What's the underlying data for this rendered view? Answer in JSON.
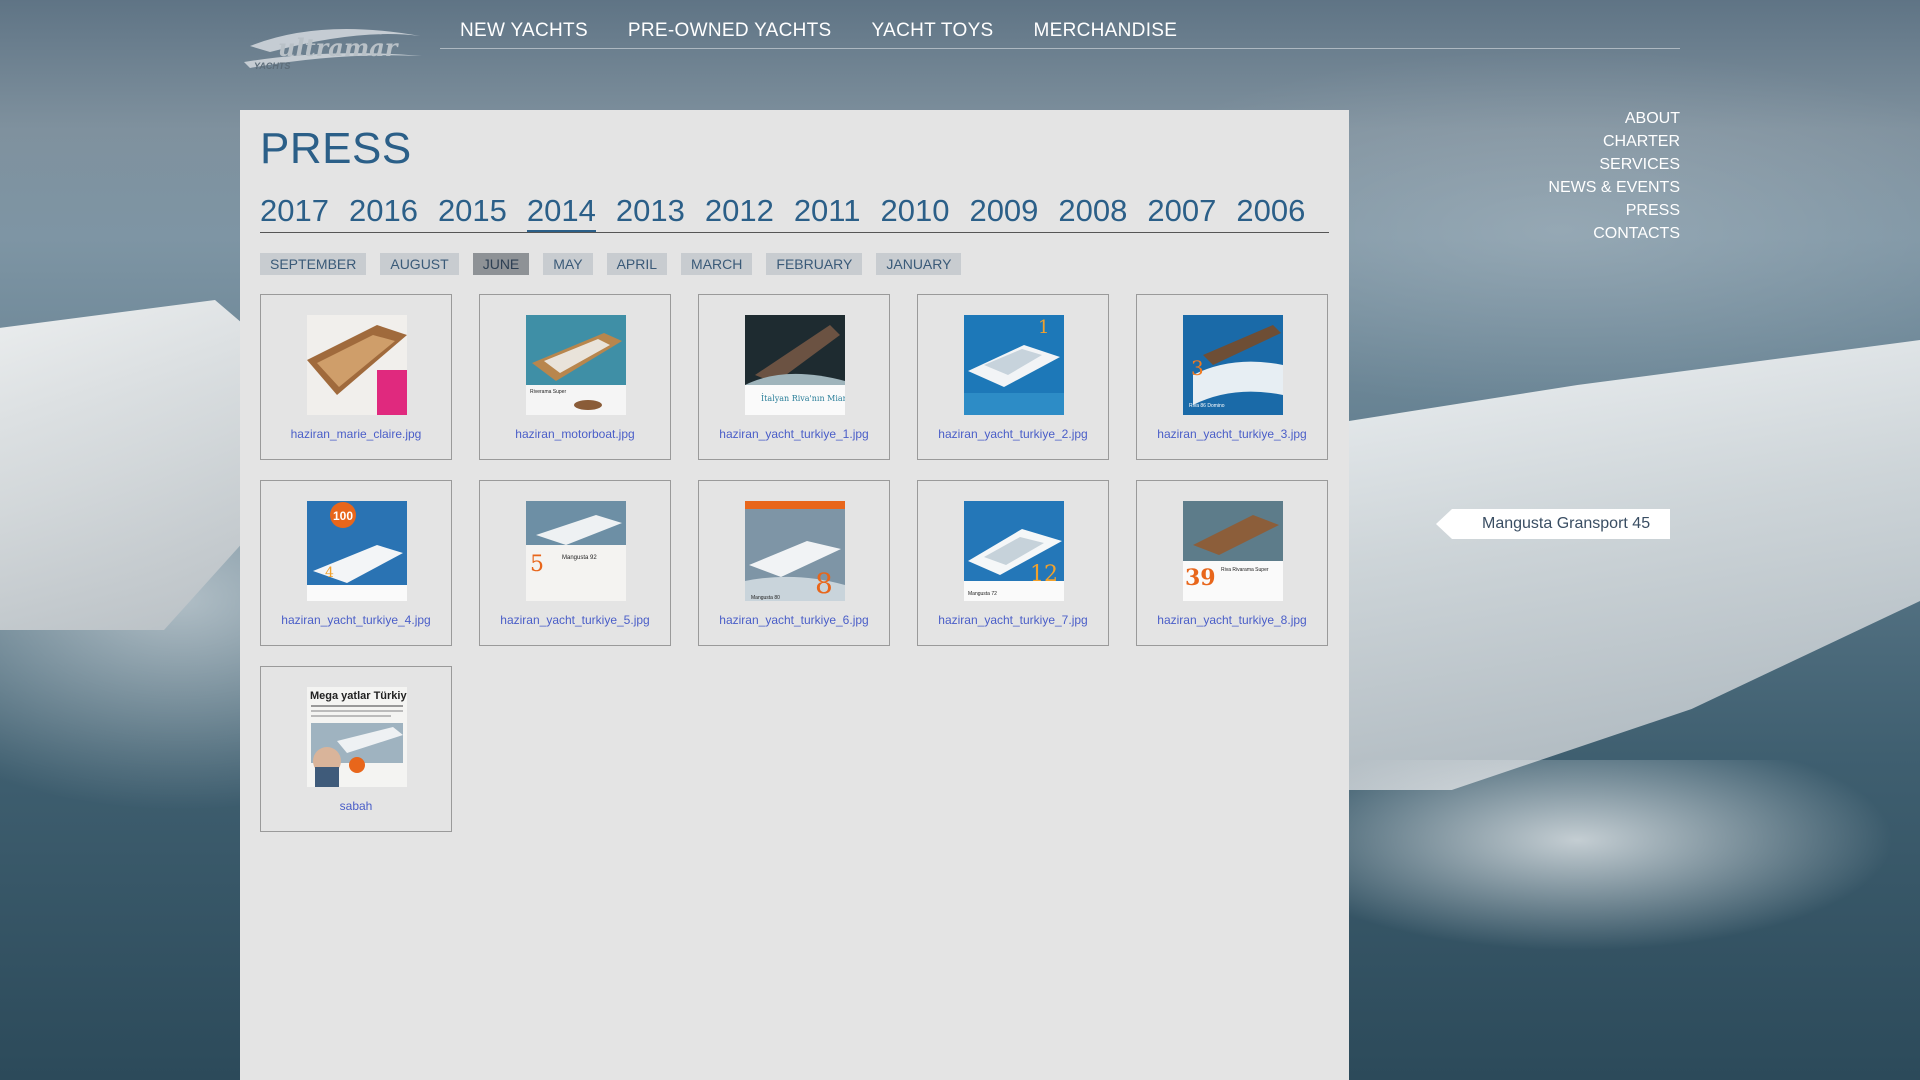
{
  "brand": {
    "logo_text": "ultramar",
    "logo_sub": "YACHTS"
  },
  "top_nav": [
    "NEW YACHTS",
    "PRE-OWNED YACHTS",
    "YACHT TOYS",
    "MERCHANDISE"
  ],
  "side_nav": [
    "ABOUT",
    "CHARTER",
    "SERVICES",
    "NEWS & EVENTS",
    "PRESS",
    "CONTACTS"
  ],
  "yacht_label": "Mangusta Gransport 45",
  "page": {
    "title": "PRESS"
  },
  "years": [
    "2017",
    "2016",
    "2015",
    "2014",
    "2013",
    "2012",
    "2011",
    "2010",
    "2009",
    "2008",
    "2007",
    "2006"
  ],
  "active_year": "2014",
  "months": [
    "SEPTEMBER",
    "AUGUST",
    "JUNE",
    "MAY",
    "APRIL",
    "MARCH",
    "FEBRUARY",
    "JANUARY"
  ],
  "active_month": "JUNE",
  "files": [
    {
      "caption": "haziran_marie_claire.jpg",
      "badge": "",
      "thumb_text": ""
    },
    {
      "caption": "haziran_motorboat.jpg",
      "badge": "",
      "thumb_text": "Riverama Super"
    },
    {
      "caption": "haziran_yacht_turkiye_1.jpg",
      "badge": "",
      "thumb_text": "İtalyan Riva'nın Miami'si"
    },
    {
      "caption": "haziran_yacht_turkiye_2.jpg",
      "badge": "1",
      "thumb_text": ""
    },
    {
      "caption": "haziran_yacht_turkiye_3.jpg",
      "badge": "3",
      "thumb_text": "Riva 86 Domino"
    },
    {
      "caption": "haziran_yacht_turkiye_4.jpg",
      "badge": "4",
      "thumb_text": "100"
    },
    {
      "caption": "haziran_yacht_turkiye_5.jpg",
      "badge": "5",
      "thumb_text": "Mangusta 92"
    },
    {
      "caption": "haziran_yacht_turkiye_6.jpg",
      "badge": "8",
      "thumb_text": "Mangusta 80"
    },
    {
      "caption": "haziran_yacht_turkiye_7.jpg",
      "badge": "12",
      "thumb_text": "Mangusta 72"
    },
    {
      "caption": "haziran_yacht_turkiye_8.jpg",
      "badge": "39",
      "thumb_text": "Riva Rivarama Super"
    },
    {
      "caption": "sabah",
      "badge": "",
      "thumb_text": "Mega yatlar Türkiy"
    }
  ],
  "colors": {
    "accent": "#2b5f88",
    "link": "#4a5ec8",
    "panel": "#e4e4e4"
  }
}
